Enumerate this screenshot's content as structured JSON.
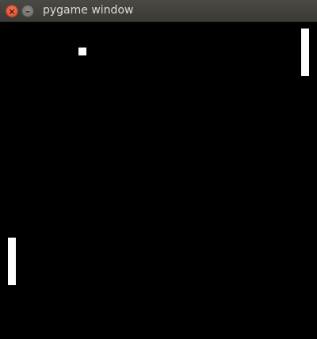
{
  "window": {
    "title": "pygame window",
    "close_icon": "close-x-icon",
    "close_glyph": "×",
    "minimize_icon": "minimize-dash-icon",
    "minimize_glyph": "–"
  },
  "game": {
    "background_color": "#000000",
    "object_color": "#ffffff"
  }
}
